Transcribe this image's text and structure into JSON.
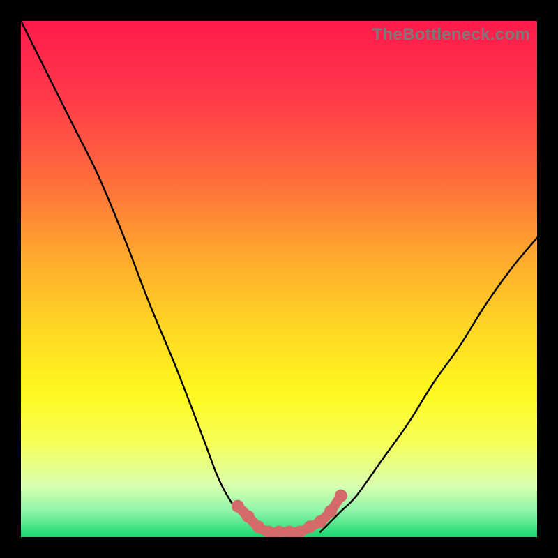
{
  "watermark": "TheBottleneck.com",
  "chart_data": {
    "type": "line",
    "title": "",
    "xlabel": "",
    "ylabel": "",
    "xlim": [
      0,
      100
    ],
    "ylim": [
      0,
      100
    ],
    "grid": false,
    "legend": false,
    "annotations": [],
    "series": [
      {
        "name": "curve-left",
        "x": [
          0,
          5,
          10,
          15,
          20,
          25,
          30,
          35,
          38,
          40,
          42,
          44,
          46,
          48
        ],
        "y": [
          100,
          90,
          80,
          70,
          58,
          45,
          33,
          20,
          12,
          8,
          5,
          3,
          2,
          1
        ]
      },
      {
        "name": "curve-right",
        "x": [
          58,
          60,
          62,
          65,
          70,
          75,
          80,
          85,
          90,
          95,
          100
        ],
        "y": [
          1,
          3,
          5,
          8,
          15,
          22,
          30,
          37,
          45,
          52,
          58
        ]
      },
      {
        "name": "overlay-dots",
        "x": [
          42,
          44,
          46,
          48,
          50,
          52,
          54,
          56,
          58,
          60,
          62
        ],
        "y": [
          6,
          4,
          2,
          1,
          1,
          1,
          1,
          2,
          3,
          5,
          8
        ]
      }
    ],
    "gradient_stops": [
      {
        "pos": 0.0,
        "color": "#ff1a4b"
      },
      {
        "pos": 0.15,
        "color": "#ff3a4a"
      },
      {
        "pos": 0.3,
        "color": "#ff6a3c"
      },
      {
        "pos": 0.45,
        "color": "#ffa62e"
      },
      {
        "pos": 0.6,
        "color": "#ffd823"
      },
      {
        "pos": 0.72,
        "color": "#fff81f"
      },
      {
        "pos": 0.82,
        "color": "#f5ff5a"
      },
      {
        "pos": 0.9,
        "color": "#d9ffb0"
      },
      {
        "pos": 0.95,
        "color": "#8ef5a8"
      },
      {
        "pos": 1.0,
        "color": "#17d86f"
      }
    ],
    "colors": {
      "curve": "#000000",
      "dots": "#d46a6a",
      "background_frame": "#000000"
    }
  }
}
